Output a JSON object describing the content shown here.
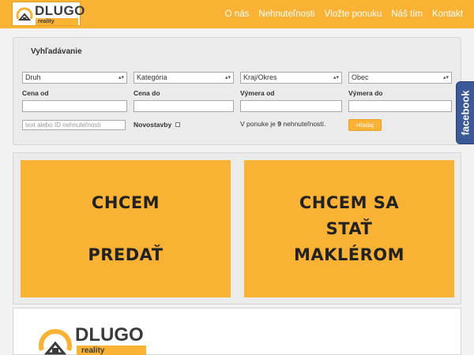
{
  "brand": {
    "name": "DLUGO",
    "sub": "reality"
  },
  "nav": {
    "items": [
      {
        "label": "O nás"
      },
      {
        "label": "Nehnuteľnosti"
      },
      {
        "label": "Vložte ponuku"
      },
      {
        "label": "Náš tím"
      },
      {
        "label": "Kontakt"
      }
    ]
  },
  "search": {
    "title": "Vyhľadávanie",
    "selects": [
      {
        "value": "Druh"
      },
      {
        "value": "Kategória"
      },
      {
        "value": "Kraj/Okres"
      },
      {
        "value": "Obec"
      }
    ],
    "labels": {
      "price_from": "Cena od",
      "price_to": "Cena do",
      "area_from": "Výmera od",
      "area_to": "Výmera do",
      "new_builds": "Novostavby"
    },
    "text_placeholder": "text alebo ID nehnuteľnosti",
    "offer_prefix": "V ponuke je",
    "offer_count": "9",
    "offer_suffix": "nehnuteľností.",
    "button": "Hľadaj"
  },
  "tiles": [
    {
      "line1": "CHCEM",
      "line2": "PREDAŤ"
    },
    {
      "line1": "CHCEM SA",
      "line2": "STAŤ",
      "line3": "MAKLÉROM"
    }
  ],
  "facebook": {
    "label": "facebook"
  },
  "colors": {
    "accent": "#f9b233",
    "facebook": "#3b5998"
  }
}
